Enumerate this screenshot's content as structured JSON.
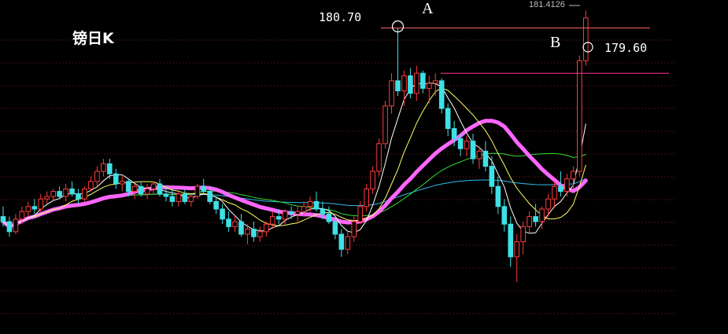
{
  "title": "镑日K",
  "annotations": {
    "label_a": "A",
    "label_b": "B",
    "value_a": "180.70",
    "value_b": "179.60",
    "high_value": "181.4126"
  },
  "colors": {
    "background": "#000000",
    "up_candle": "#ff3b3b",
    "down_candle": "#3fe0e6",
    "grid": "#7a1f1f",
    "ma5": "#ffffff",
    "ma10": "#ffff66",
    "ma20": "#ff66ff",
    "ma30": "#33dd33",
    "ma60": "#33bbee",
    "resistance_line": "#ff6666",
    "support_line": "#ff3399"
  },
  "chart_data": {
    "type": "candlestick",
    "title": "镑日K",
    "ylim": [
      170.5,
      181.5
    ],
    "grid": true,
    "levels": [
      {
        "label": "A",
        "value": 180.7
      },
      {
        "label": "B",
        "value": 179.6
      },
      {
        "label": "",
        "value": 178.9
      }
    ],
    "last_high": 181.4126,
    "candles": [
      [
        173.2,
        173.6,
        172.8,
        173.0
      ],
      [
        173.0,
        173.2,
        172.4,
        172.6
      ],
      [
        172.6,
        173.3,
        172.5,
        173.1
      ],
      [
        173.1,
        173.6,
        172.9,
        173.4
      ],
      [
        173.4,
        173.8,
        173.2,
        173.6
      ],
      [
        173.6,
        173.9,
        173.3,
        173.5
      ],
      [
        173.5,
        174.1,
        173.4,
        173.9
      ],
      [
        173.9,
        174.2,
        173.7,
        174.0
      ],
      [
        174.0,
        174.3,
        173.8,
        174.2
      ],
      [
        174.2,
        174.4,
        173.9,
        174.0
      ],
      [
        174.0,
        174.5,
        173.8,
        174.3
      ],
      [
        174.3,
        174.6,
        174.0,
        174.1
      ],
      [
        174.1,
        174.3,
        173.7,
        173.9
      ],
      [
        173.9,
        174.4,
        173.8,
        174.3
      ],
      [
        174.3,
        174.8,
        174.2,
        174.6
      ],
      [
        174.6,
        175.2,
        174.4,
        175.0
      ],
      [
        175.0,
        175.5,
        174.8,
        175.3
      ],
      [
        175.3,
        175.5,
        174.7,
        174.9
      ],
      [
        174.9,
        175.1,
        174.3,
        174.5
      ],
      [
        174.5,
        174.8,
        174.2,
        174.6
      ],
      [
        174.6,
        174.7,
        174.0,
        174.2
      ],
      [
        174.2,
        174.5,
        173.9,
        174.4
      ],
      [
        174.4,
        174.6,
        174.0,
        174.1
      ],
      [
        174.1,
        174.5,
        173.9,
        174.3
      ],
      [
        174.3,
        174.6,
        174.1,
        174.5
      ],
      [
        174.5,
        174.7,
        174.0,
        174.1
      ],
      [
        174.1,
        174.4,
        173.8,
        174.0
      ],
      [
        174.0,
        174.3,
        173.6,
        173.8
      ],
      [
        173.8,
        174.2,
        173.6,
        174.1
      ],
      [
        174.1,
        174.3,
        173.7,
        173.8
      ],
      [
        173.8,
        174.1,
        173.6,
        174.0
      ],
      [
        174.0,
        174.5,
        173.9,
        174.4
      ],
      [
        174.4,
        174.7,
        174.1,
        174.2
      ],
      [
        174.2,
        174.4,
        173.7,
        173.8
      ],
      [
        173.8,
        174.0,
        173.3,
        173.5
      ],
      [
        173.5,
        173.7,
        172.9,
        173.1
      ],
      [
        173.1,
        173.4,
        172.6,
        172.8
      ],
      [
        172.8,
        173.2,
        172.6,
        173.0
      ],
      [
        173.0,
        173.3,
        172.4,
        172.5
      ],
      [
        172.5,
        172.9,
        172.1,
        172.7
      ],
      [
        172.7,
        173.0,
        172.2,
        172.4
      ],
      [
        172.4,
        172.8,
        172.2,
        172.6
      ],
      [
        172.6,
        173.0,
        172.4,
        172.9
      ],
      [
        172.9,
        173.4,
        172.7,
        173.2
      ],
      [
        173.2,
        173.5,
        172.9,
        173.1
      ],
      [
        173.1,
        173.5,
        172.9,
        173.4
      ],
      [
        173.4,
        173.6,
        173.1,
        173.3
      ],
      [
        173.3,
        173.6,
        173.0,
        173.4
      ],
      [
        173.4,
        173.8,
        173.2,
        173.6
      ],
      [
        173.6,
        174.0,
        173.4,
        173.8
      ],
      [
        173.8,
        174.2,
        173.4,
        173.5
      ],
      [
        173.5,
        173.8,
        173.1,
        173.3
      ],
      [
        173.3,
        173.6,
        172.9,
        173.0
      ],
      [
        173.0,
        173.2,
        172.3,
        172.5
      ],
      [
        172.5,
        172.7,
        171.6,
        171.9
      ],
      [
        171.9,
        172.6,
        171.7,
        172.4
      ],
      [
        172.4,
        173.2,
        172.2,
        173.0
      ],
      [
        173.0,
        173.8,
        172.9,
        173.6
      ],
      [
        173.6,
        174.5,
        173.4,
        174.3
      ],
      [
        174.3,
        175.2,
        174.1,
        175.0
      ],
      [
        175.0,
        176.3,
        174.8,
        176.1
      ],
      [
        176.1,
        177.8,
        175.9,
        177.6
      ],
      [
        177.6,
        178.9,
        177.3,
        178.6
      ],
      [
        178.6,
        180.7,
        178.0,
        178.2
      ],
      [
        178.2,
        179.0,
        177.6,
        178.8
      ],
      [
        178.8,
        179.1,
        177.9,
        178.1
      ],
      [
        178.1,
        179.2,
        177.8,
        178.9
      ],
      [
        178.9,
        179.0,
        178.1,
        178.3
      ],
      [
        178.3,
        178.8,
        177.7,
        178.5
      ],
      [
        178.5,
        178.9,
        178.0,
        178.6
      ],
      [
        178.6,
        178.7,
        177.3,
        177.5
      ],
      [
        177.5,
        177.7,
        176.4,
        176.7
      ],
      [
        176.7,
        177.0,
        176.0,
        176.3
      ],
      [
        176.3,
        176.5,
        175.6,
        175.9
      ],
      [
        175.9,
        176.4,
        175.6,
        176.2
      ],
      [
        176.2,
        176.5,
        175.3,
        175.5
      ],
      [
        175.5,
        176.0,
        175.1,
        175.8
      ],
      [
        175.8,
        176.2,
        175.0,
        175.2
      ],
      [
        175.2,
        175.6,
        174.1,
        174.4
      ],
      [
        174.4,
        174.8,
        173.3,
        173.6
      ],
      [
        173.6,
        173.9,
        172.6,
        172.9
      ],
      [
        172.9,
        173.2,
        171.2,
        171.6
      ],
      [
        171.6,
        172.5,
        170.6,
        172.2
      ],
      [
        172.2,
        173.0,
        171.7,
        172.8
      ],
      [
        172.8,
        173.4,
        172.5,
        173.2
      ],
      [
        173.2,
        173.7,
        172.8,
        173.0
      ],
      [
        173.0,
        173.6,
        172.7,
        173.5
      ],
      [
        173.5,
        174.1,
        173.2,
        173.9
      ],
      [
        173.9,
        174.6,
        173.6,
        174.4
      ],
      [
        174.4,
        175.0,
        174.0,
        174.2
      ],
      [
        174.2,
        174.9,
        174.0,
        174.7
      ],
      [
        174.7,
        175.2,
        174.3,
        175.0
      ],
      [
        175.0,
        179.6,
        174.8,
        179.4
      ],
      [
        179.4,
        181.4,
        179.2,
        181.1
      ]
    ]
  }
}
